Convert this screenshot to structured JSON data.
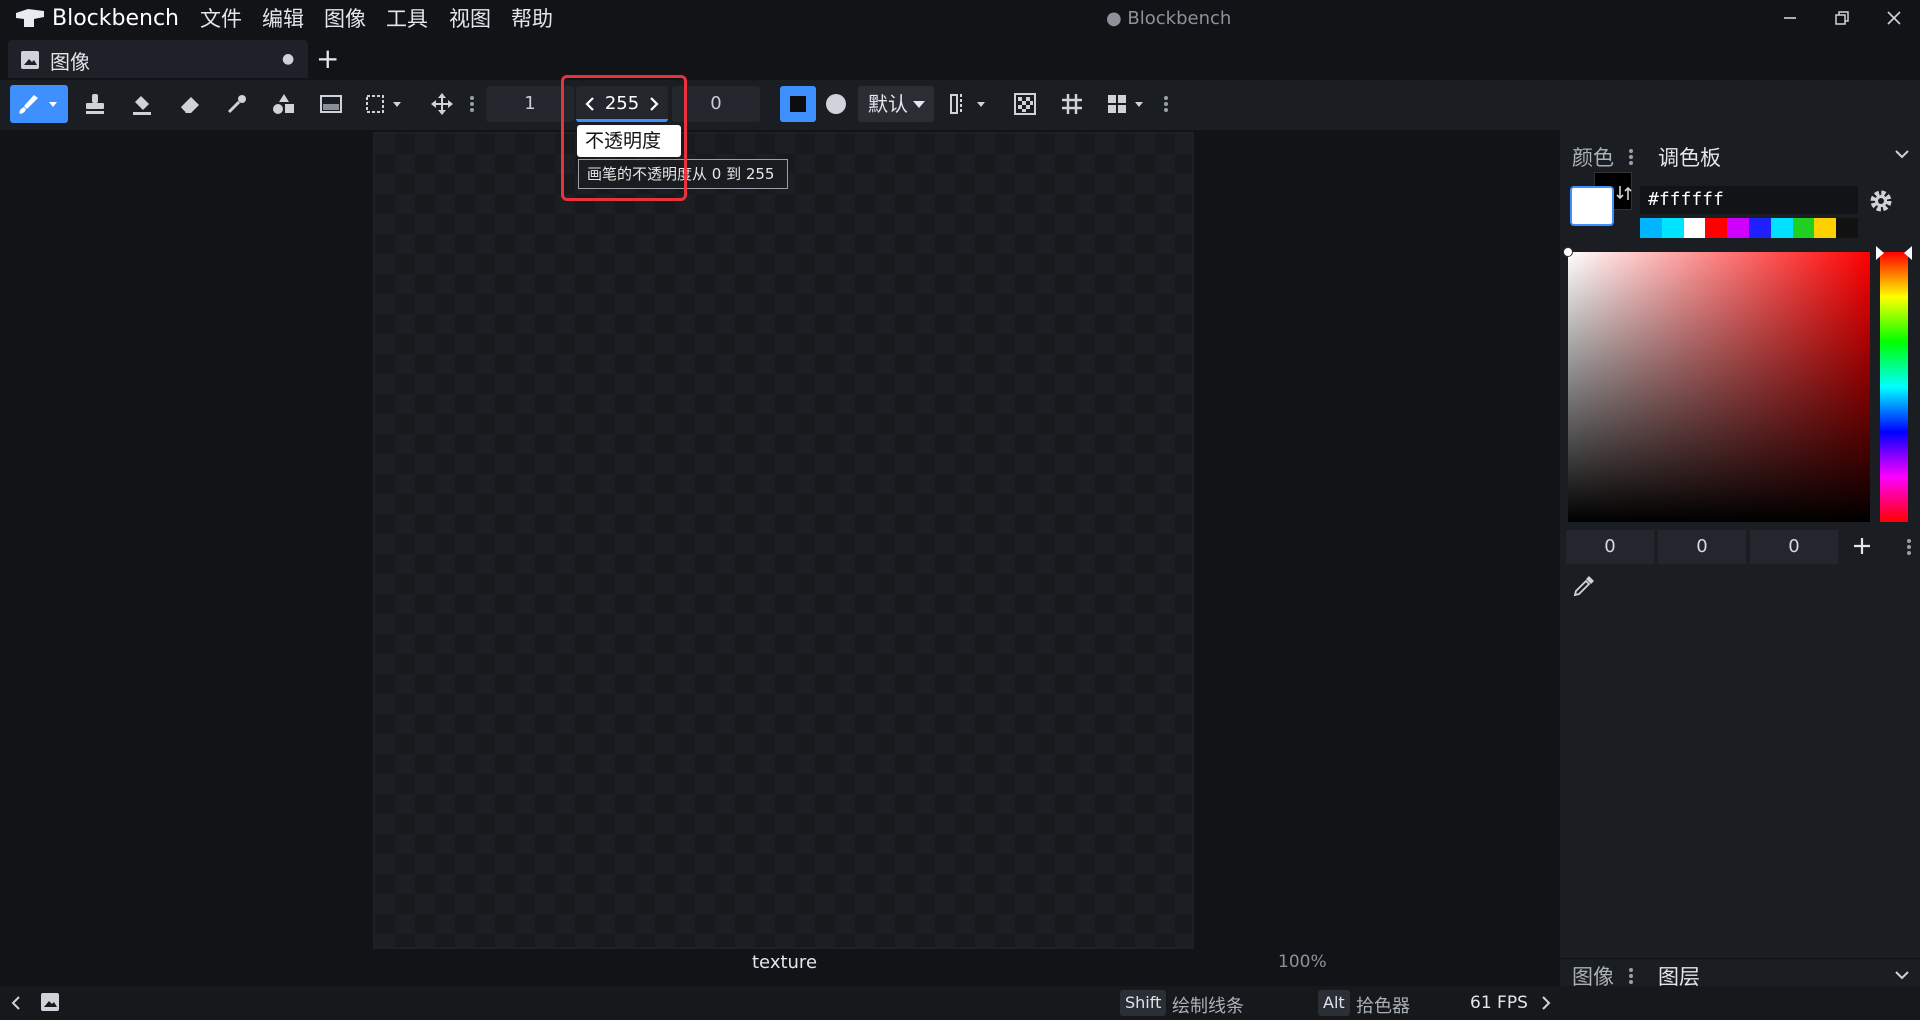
{
  "app": {
    "name": "Blockbench",
    "window_title": "● Blockbench"
  },
  "menu": [
    "文件",
    "编辑",
    "图像",
    "工具",
    "视图",
    "帮助"
  ],
  "tab": {
    "label": "图像",
    "unsaved_dot": "●",
    "add": "+"
  },
  "toolbar": {
    "brush_size": "1",
    "opacity": "255",
    "softness": "0",
    "blend_mode": "默认"
  },
  "tooltip": {
    "title": "不透明度",
    "description": "画笔的不透明度从 0 到 255"
  },
  "canvas": {
    "texture_name": "texture",
    "zoom": "100%"
  },
  "color_panel": {
    "tabs": [
      "颜色",
      "调色板"
    ],
    "hex": "#ffffff",
    "primary_color": "#ffffff",
    "secondary_color": "#000000",
    "palette": [
      "#00b4ff",
      "#00e5ff",
      "#ffffff",
      "#ff0000",
      "#d000ff",
      "#2020ff",
      "#00e0ff",
      "#20d020",
      "#ffd000",
      "#111111"
    ],
    "hsv_hue_color": "#ff0000",
    "rgb": [
      "0",
      "0",
      "0"
    ]
  },
  "bottom_panel": {
    "tabs": [
      "图像",
      "图层"
    ]
  },
  "statusbar": {
    "shift_key": "Shift",
    "shift_hint": "绘制线条",
    "alt_key": "Alt",
    "alt_hint": "拾色器",
    "fps": "61 FPS"
  },
  "colors": {
    "accent": "#3e90ff",
    "highlight": "#e8323c"
  }
}
